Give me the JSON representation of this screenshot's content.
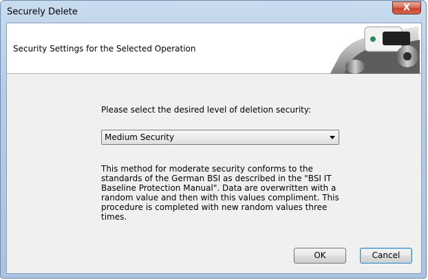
{
  "window": {
    "title": "Securely Delete",
    "close_label": "X"
  },
  "header": {
    "subtitle": "Security Settings for the Selected Operation",
    "image": "shredder-device-image"
  },
  "main": {
    "prompt": "Please select the desired level of deletion security:",
    "security_select": {
      "value": "Medium Security"
    },
    "description": "This method for moderate security conforms to the standards of the German BSI as described in the \"BSI IT Baseline Protection Manual\". Data are overwritten with a random value and then with this values compliment. This procedure is completed with new random values three times."
  },
  "buttons": {
    "ok": "OK",
    "cancel": "Cancel"
  }
}
